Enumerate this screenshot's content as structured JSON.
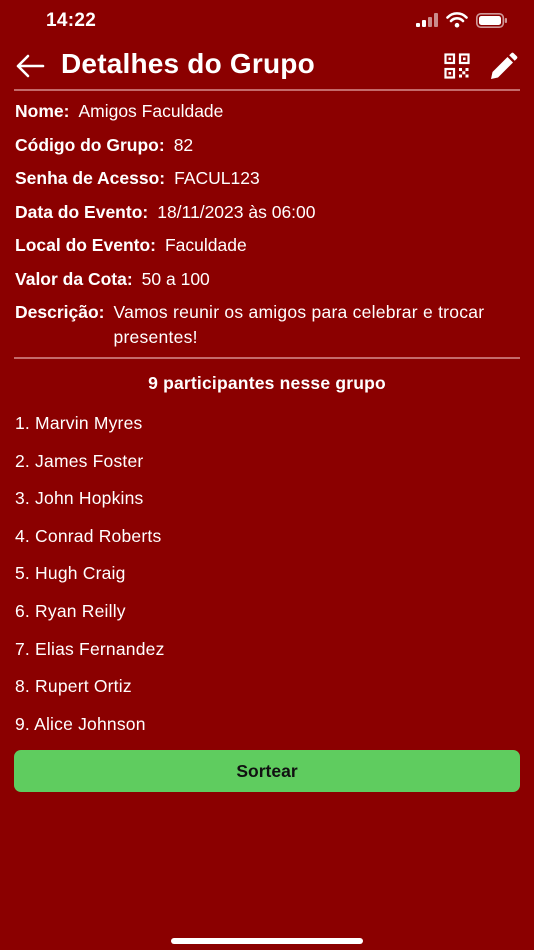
{
  "status_bar": {
    "time": "14:22"
  },
  "header": {
    "title": "Detalhes do Grupo",
    "back_icon": "arrow-left-icon",
    "qr_icon": "qr-code-icon",
    "edit_icon": "pencil-icon"
  },
  "details": {
    "nome_label": "Nome:",
    "nome_value": "Amigos Faculdade",
    "codigo_label": "Código do Grupo:",
    "codigo_value": "82",
    "senha_label": "Senha de Acesso:",
    "senha_value": "FACUL123",
    "data_label": "Data do Evento:",
    "data_value": "18/11/2023 às 06:00",
    "local_label": "Local do Evento:",
    "local_value": "Faculdade",
    "valor_label": "Valor da Cota:",
    "valor_value": "50 a 100",
    "descricao_label": "Descrição:",
    "descricao_value": "Vamos reunir os amigos para celebrar e trocar presentes!"
  },
  "participants": {
    "title": "9 participantes nesse grupo",
    "items": [
      "1. Marvin Myres",
      "2. James Foster",
      "3. John Hopkins",
      "4. Conrad Roberts",
      "5. Hugh Craig",
      "6. Ryan Reilly",
      "7. Elias Fernandez",
      "8. Rupert Ortiz",
      "9. Alice Johnson"
    ]
  },
  "actions": {
    "sortear_label": "Sortear"
  },
  "colors": {
    "background": "#8b0000",
    "button": "#5fcc5f",
    "text": "#ffffff"
  }
}
